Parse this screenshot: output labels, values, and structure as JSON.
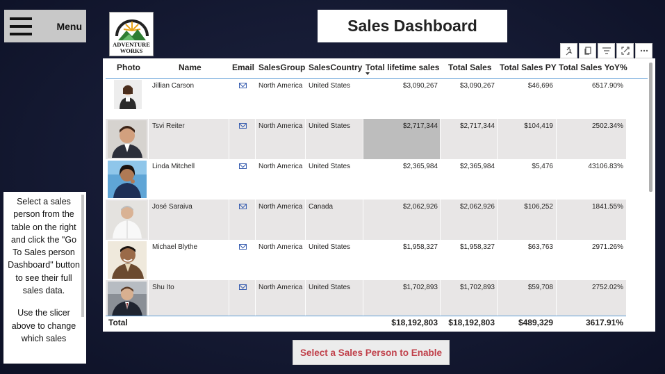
{
  "menu": {
    "label": "Menu"
  },
  "logo": {
    "line1": "ADVENTURE",
    "line2": "WORKS"
  },
  "header": {
    "title": "Sales Dashboard"
  },
  "toolbar": {
    "icons": [
      "pin-icon",
      "copy-icon",
      "filter-icon",
      "focus-mode-icon",
      "more-options-icon"
    ]
  },
  "table": {
    "columns": [
      "Photo",
      "Name",
      "Email",
      "SalesGroup",
      "SalesCountry",
      "Total lifetime sales",
      "Total Sales",
      "Total Sales PY",
      "Total Sales YoY%"
    ],
    "sorted_column": "Total lifetime sales",
    "sort_direction": "descending",
    "rows": [
      {
        "name": "Jillian Carson",
        "group": "North America",
        "country": "United States",
        "lifetime": "$3,090,267",
        "total": "$3,090,267",
        "py": "$46,696",
        "yoy": "6517.90%"
      },
      {
        "name": "Tsvi Reiter",
        "group": "North America",
        "country": "United States",
        "lifetime": "$2,717,344",
        "total": "$2,717,344",
        "py": "$104,419",
        "yoy": "2502.34%"
      },
      {
        "name": "Linda Mitchell",
        "group": "North America",
        "country": "United States",
        "lifetime": "$2,365,984",
        "total": "$2,365,984",
        "py": "$5,476",
        "yoy": "43106.83%"
      },
      {
        "name": "José Saraiva",
        "group": "North America",
        "country": "Canada",
        "lifetime": "$2,062,926",
        "total": "$2,062,926",
        "py": "$106,252",
        "yoy": "1841.55%"
      },
      {
        "name": "Michael Blythe",
        "group": "North America",
        "country": "United States",
        "lifetime": "$1,958,327",
        "total": "$1,958,327",
        "py": "$63,763",
        "yoy": "2971.26%"
      },
      {
        "name": "Shu Ito",
        "group": "North America",
        "country": "United States",
        "lifetime": "$1,702,893",
        "total": "$1,702,893",
        "py": "$59,708",
        "yoy": "2752.02%"
      }
    ],
    "totals": {
      "label": "Total",
      "lifetime": "$18,192,803",
      "total": "$18,192,803",
      "py": "$489,329",
      "yoy": "3617.91%"
    }
  },
  "info": {
    "para1": "Select a sales person from the table on the right and click the \"Go To Sales person Dashboard\" button to see their full sales data.",
    "para2": "Use the slicer above to change which sales"
  },
  "cta": {
    "label": "Select a Sales Person to Enable"
  },
  "colors": {
    "accent_line": "#5b9bd5",
    "cta_text": "#c0404a",
    "background": "#151a33"
  }
}
